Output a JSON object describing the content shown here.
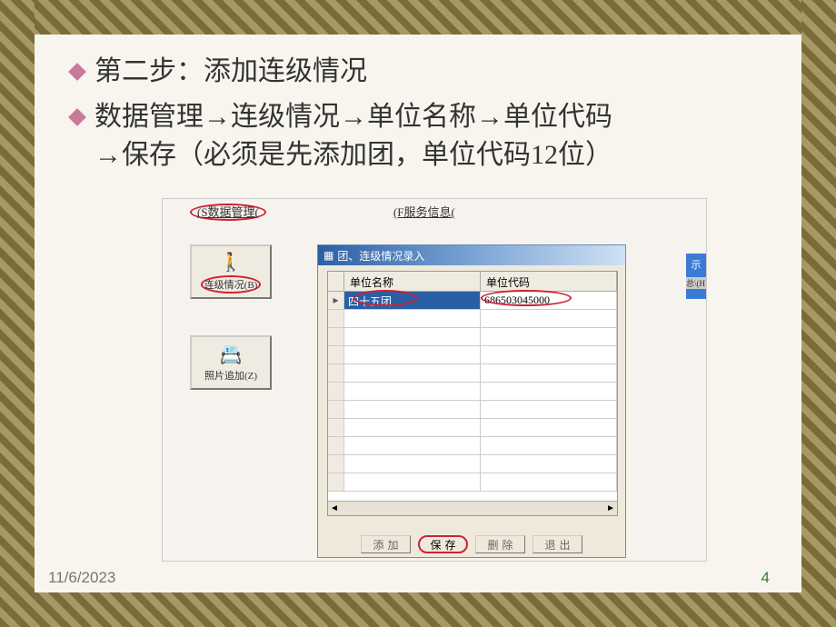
{
  "bullets": {
    "line1": "第二步：添加连级情况",
    "line2a": "数据管理→连级情况→单位名称→单位代码",
    "line2b": "→保存（必须是先添加团，单位代码12位）"
  },
  "menu": {
    "data_mgmt": "(S数据管理(",
    "service_info": "(F服务信息("
  },
  "sidebar": {
    "btn1_label": "连级情况(B)",
    "btn2_label": "照片追加(Z)"
  },
  "dialog": {
    "title": "团、连级情况录入",
    "col_marker": "",
    "col_unit_name": "单位名称",
    "col_unit_code": "单位代码",
    "row1_marker": "▸",
    "row1_name": "四十五团",
    "row1_code": "686503045000",
    "btn_add": "添加",
    "btn_save": "保存",
    "btn_delete": "删除",
    "btn_exit": "退出"
  },
  "right_frag": {
    "text1": "示",
    "text2": "总\\(H"
  },
  "footer": {
    "date": "11/6/2023",
    "page": "4"
  }
}
